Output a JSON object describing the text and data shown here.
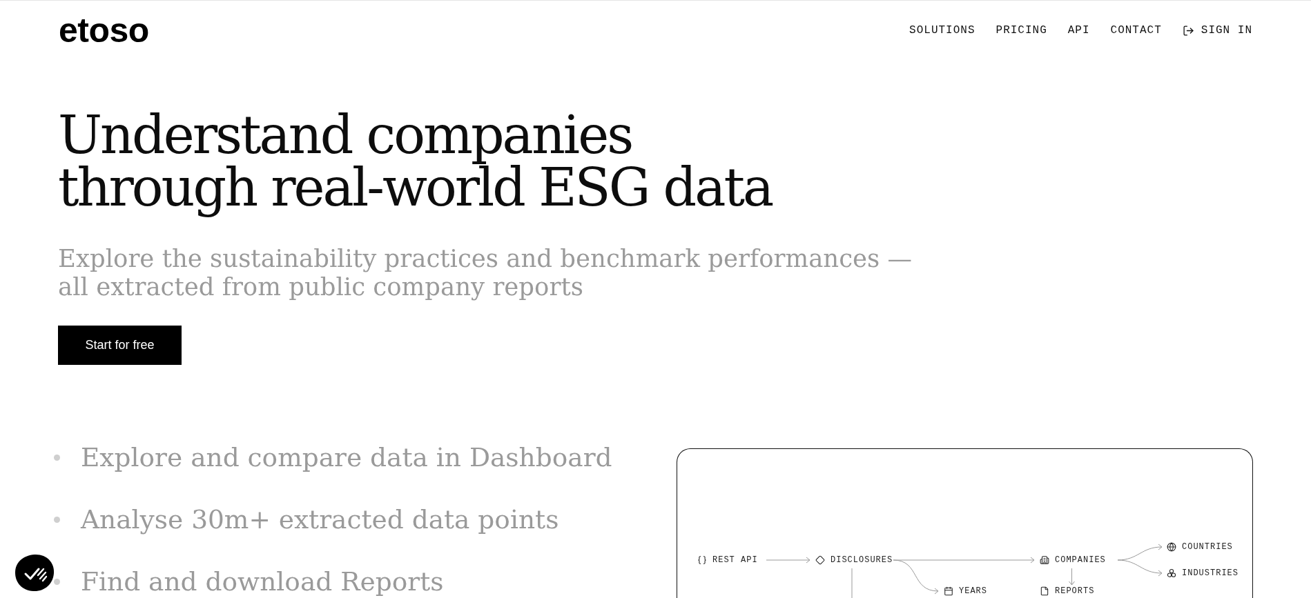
{
  "header": {
    "logo": "etoso",
    "nav": [
      {
        "label": "SOLUTIONS",
        "kind": "text"
      },
      {
        "label": "PRICING",
        "kind": "text"
      },
      {
        "label": "API",
        "kind": "text"
      },
      {
        "label": "CONTACT",
        "kind": "text"
      },
      {
        "label": "SIGN IN",
        "kind": "action"
      }
    ]
  },
  "hero": {
    "headline": [
      "Understand companies",
      "through real-world ESG data"
    ],
    "subheading": [
      "Explore the sustainability practices and benchmark performances —",
      "all extracted from public company reports"
    ],
    "cta": "Start for free"
  },
  "features": [
    "Explore and compare data in Dashboard",
    "Analyse 30m+ extracted data points",
    "Find and download Reports"
  ],
  "diagram": {
    "nodes": [
      "REST API",
      "DISCLOSURES",
      "COMPANIES",
      "COUNTRIES",
      "INDUSTRIES",
      "YEARS",
      "REPORTS"
    ]
  }
}
